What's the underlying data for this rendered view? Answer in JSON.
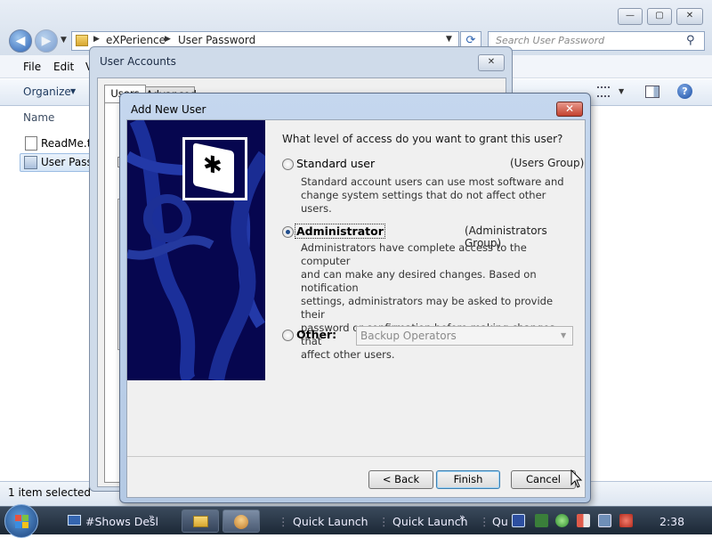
{
  "explorer": {
    "breadcrumb": [
      "eXPerience",
      "User Password"
    ],
    "search_placeholder": "Search User Password",
    "menu": [
      "File",
      "Edit",
      "V"
    ],
    "organize_label": "Organize",
    "column_name": "Name",
    "files": [
      "ReadMe.tx",
      "User Passv"
    ],
    "status": "1 item selected",
    "window_buttons": {
      "minimize": "—",
      "maximize": "▢",
      "close": "✕"
    }
  },
  "user_accounts": {
    "title": "User Accounts",
    "tabs": [
      "Users",
      "Advanced"
    ],
    "close": "✕"
  },
  "add_user": {
    "title": "Add New User",
    "close": "✕",
    "question": "What level of access do you want to grant this user?",
    "standard": {
      "label": "Standard user",
      "group": "(Users Group)",
      "desc": [
        "Standard account users can use most software and",
        "change system settings that do not affect other users."
      ],
      "selected": false
    },
    "administrator": {
      "label": "Administrator",
      "group": "(Administrators Group)",
      "desc": [
        "Administrators have complete access to the computer",
        "and can make any desired changes. Based on notification",
        "settings, administrators may be asked to provide their",
        "password or confirmation before making changes that",
        "affect other users."
      ],
      "selected": true
    },
    "other": {
      "label": "Other:",
      "selected": false,
      "dropdown_value": "Backup Operators"
    },
    "buttons": {
      "back": "< Back",
      "finish": "Finish",
      "cancel": "Cancel"
    }
  },
  "taskbar": {
    "items": [
      "#Shows Desl",
      "Quick Launch",
      "Quick Launch",
      "Qu"
    ],
    "clock": "2:38"
  }
}
